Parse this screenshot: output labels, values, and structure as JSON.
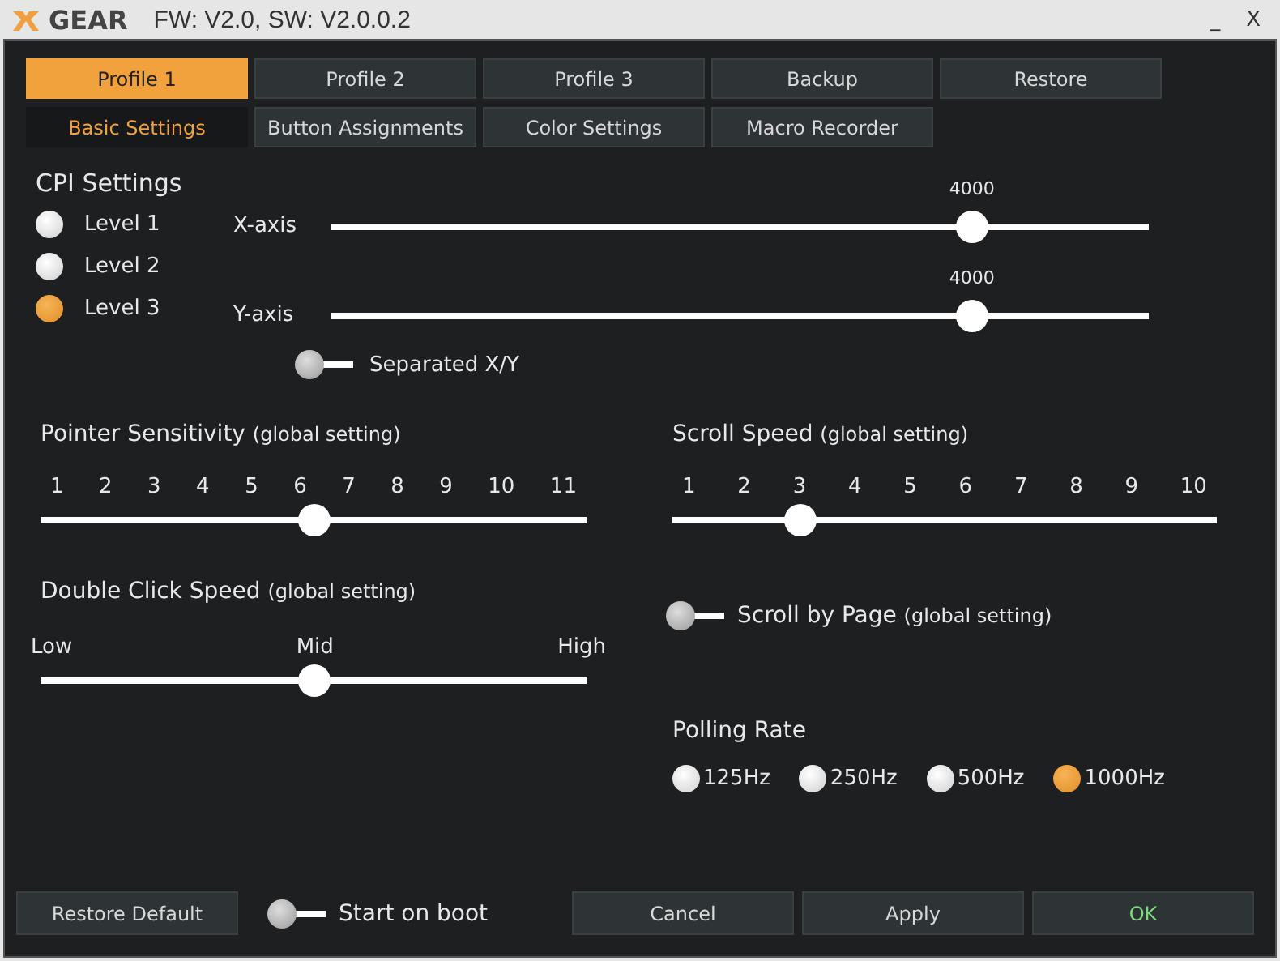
{
  "window": {
    "logo": "GEAR",
    "title": "FW: V2.0, SW: V2.0.0.2",
    "controls": [
      "_",
      "X"
    ]
  },
  "profile_tabs": [
    {
      "label": "Profile 1",
      "selected": true
    },
    {
      "label": "Profile 2",
      "selected": false
    },
    {
      "label": "Profile 3",
      "selected": false
    },
    {
      "label": "Backup",
      "selected": false
    },
    {
      "label": "Restore",
      "selected": false
    }
  ],
  "page_tabs": [
    {
      "label": "Basic Settings",
      "selected": true
    },
    {
      "label": "Button Assignments",
      "selected": false
    },
    {
      "label": "Color Settings",
      "selected": false
    },
    {
      "label": "Macro Recorder",
      "selected": false
    }
  ],
  "cpi": {
    "title": "CPI Settings",
    "levels": [
      {
        "label": "Level 1",
        "selected": false
      },
      {
        "label": "Level 2",
        "selected": false
      },
      {
        "label": "Level 3",
        "selected": true
      }
    ],
    "axes": [
      {
        "label": "X-axis",
        "reading": "4000",
        "level": 0.784
      },
      {
        "label": "Y-axis",
        "reading": "4000",
        "level": 0.784
      }
    ],
    "separated": {
      "label": "Separated X/Y",
      "on": false
    }
  },
  "pointer_sensitivity": {
    "title": "Pointer Sensitivity",
    "note": "(global setting)",
    "ticks": [
      "1",
      "2",
      "3",
      "4",
      "5",
      "6",
      "7",
      "8",
      "9",
      "10",
      "11"
    ],
    "level": 0.5
  },
  "scroll_speed": {
    "title": "Scroll Speed",
    "note": "(global setting)",
    "ticks": [
      "1",
      "2",
      "3",
      "4",
      "5",
      "6",
      "7",
      "8",
      "9",
      "10"
    ],
    "level": 0.235
  },
  "double_click_speed": {
    "title": "Double Click Speed",
    "note": "(global setting)",
    "ticks": [
      "Low",
      "Mid",
      "High"
    ],
    "level": 0.5
  },
  "scroll_by_page": {
    "label": "Scroll by Page",
    "note": "(global setting)",
    "on": false
  },
  "polling_rate": {
    "title": "Polling Rate",
    "options": [
      {
        "label": "125Hz",
        "selected": false
      },
      {
        "label": "250Hz",
        "selected": false
      },
      {
        "label": "500Hz",
        "selected": false
      },
      {
        "label": "1000Hz",
        "selected": true
      }
    ]
  },
  "footer": {
    "restore": "Restore Default",
    "start_on_boot": {
      "label": "Start on boot",
      "on": false
    },
    "buttons": [
      "Cancel",
      "Apply",
      "OK"
    ]
  }
}
